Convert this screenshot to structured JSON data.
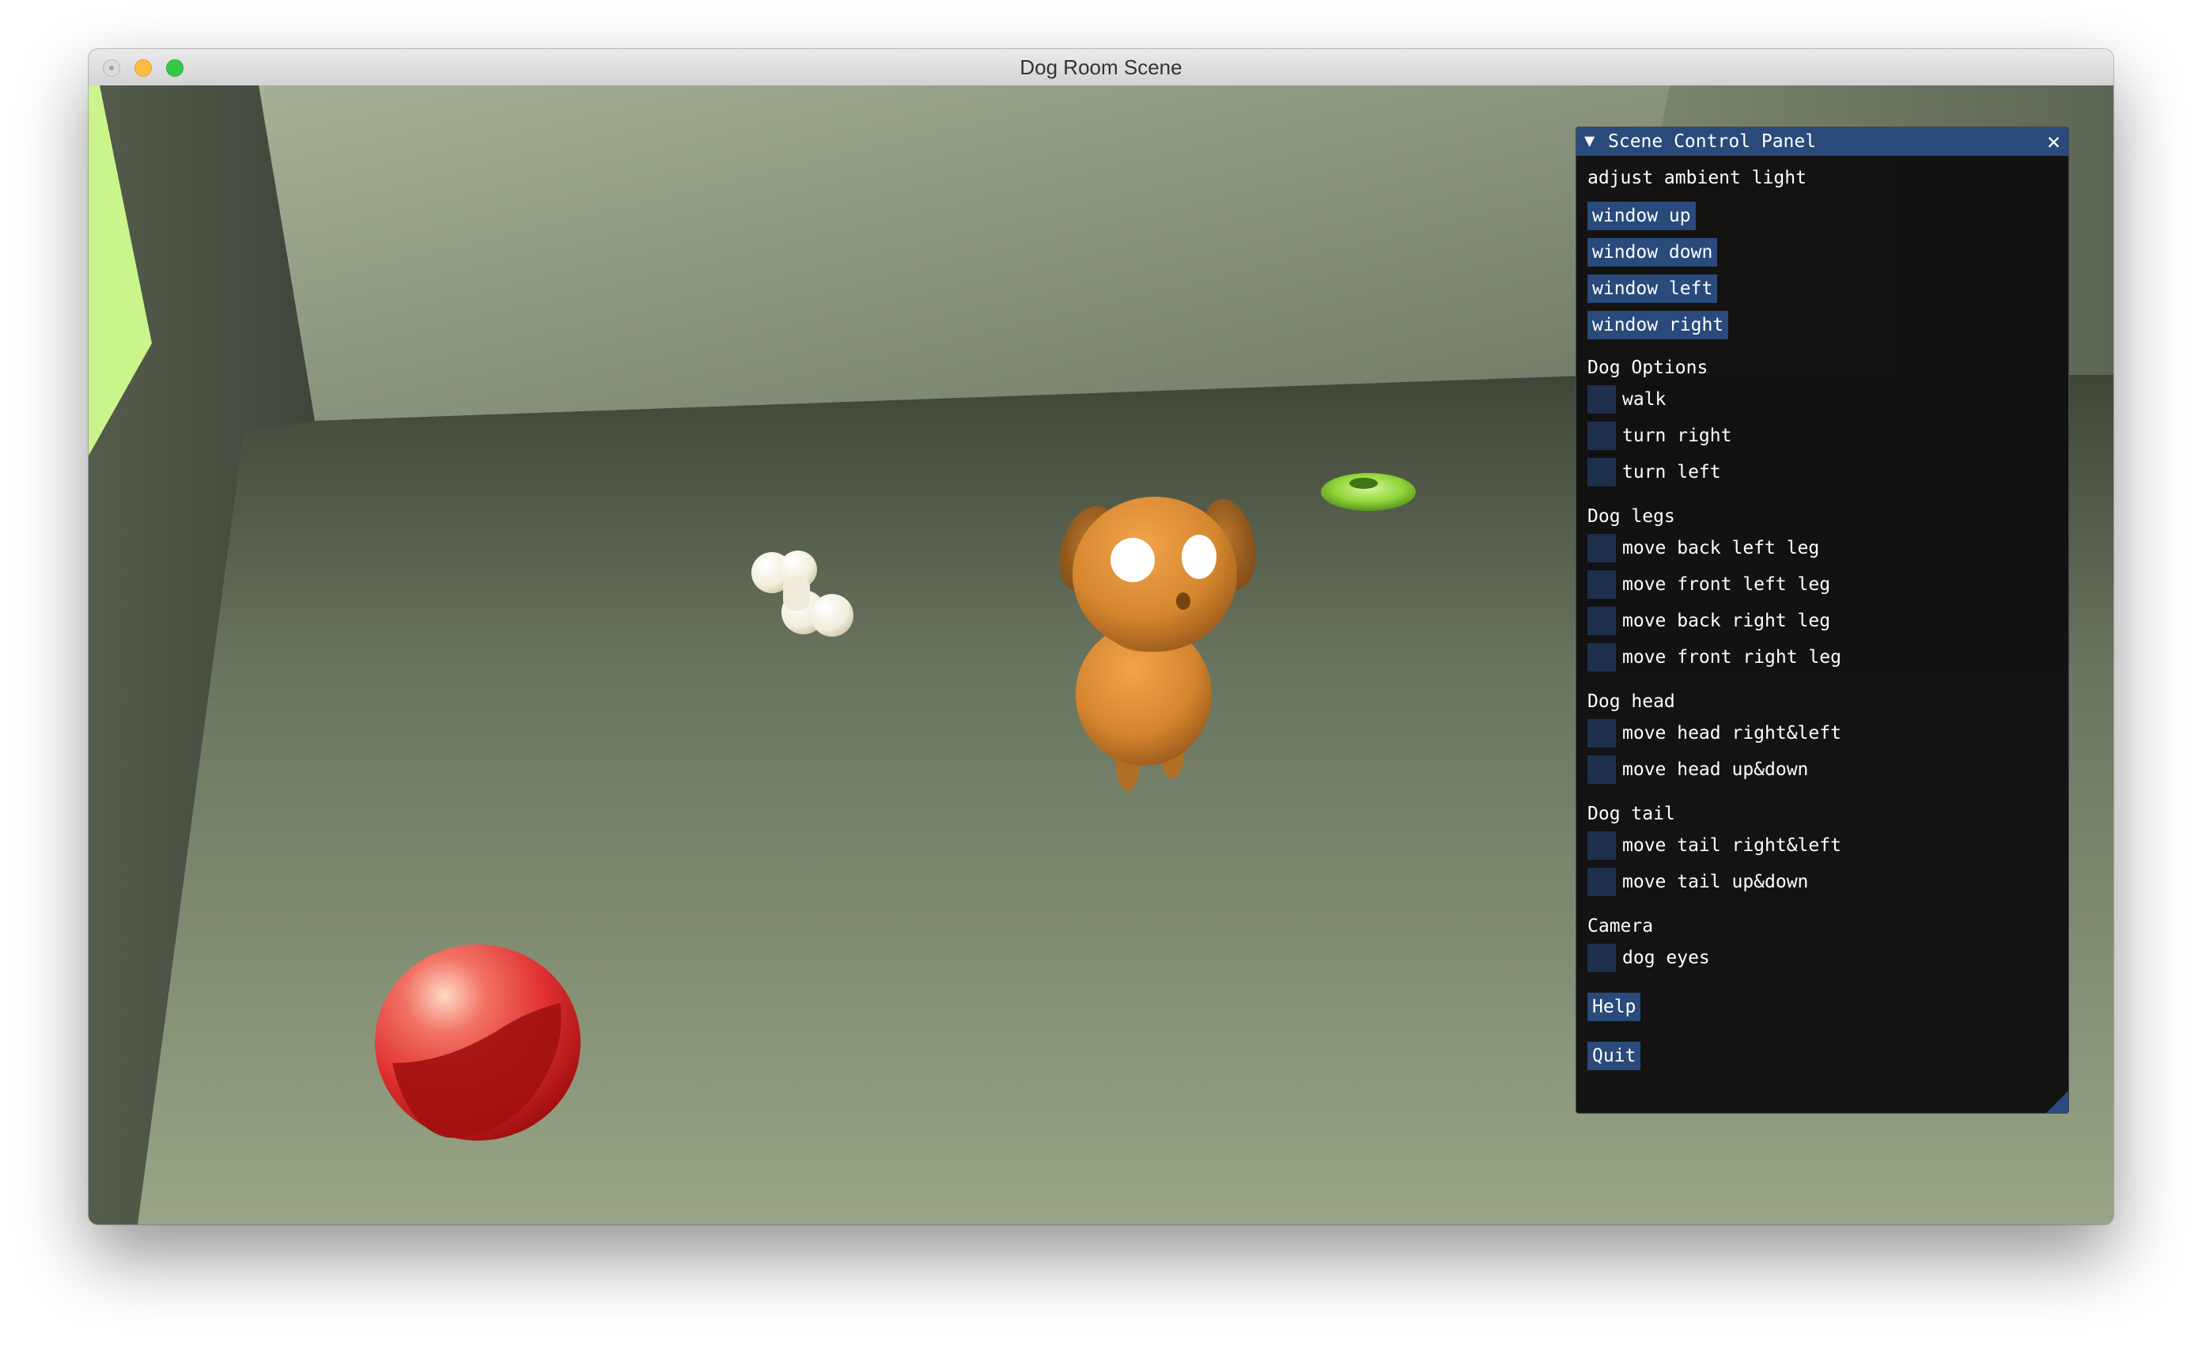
{
  "window": {
    "title": "Dog Room Scene"
  },
  "panel": {
    "title": "Scene Control Panel",
    "collapse_glyph": "▼",
    "close_glyph": "✕",
    "ambient_label": "adjust ambient light",
    "window_buttons": [
      "window up",
      "window down",
      "window left",
      "window right"
    ],
    "dog_options": {
      "label": "Dog Options",
      "items": [
        "walk",
        "turn right",
        "turn left"
      ]
    },
    "dog_legs": {
      "label": "Dog legs",
      "items": [
        "move back left leg",
        "move front left leg",
        "move back right leg",
        "move front right leg"
      ]
    },
    "dog_head": {
      "label": "Dog head",
      "items": [
        "move head right&left",
        "move head up&down"
      ]
    },
    "dog_tail": {
      "label": "Dog tail",
      "items": [
        "move tail right&left",
        "move tail up&down"
      ]
    },
    "camera": {
      "label": "Camera",
      "items": [
        "dog eyes"
      ]
    },
    "help_label": "Help",
    "quit_label": "Quit"
  },
  "colors": {
    "panel_accent": "#294a7a",
    "checkbox_bg": "#1d2f4a",
    "dog_body": "#d48a34",
    "ball": "#d82f2f",
    "frisbee": "#8fd23a",
    "bone": "#f4f1e2",
    "window_light": "#c9f58b"
  }
}
